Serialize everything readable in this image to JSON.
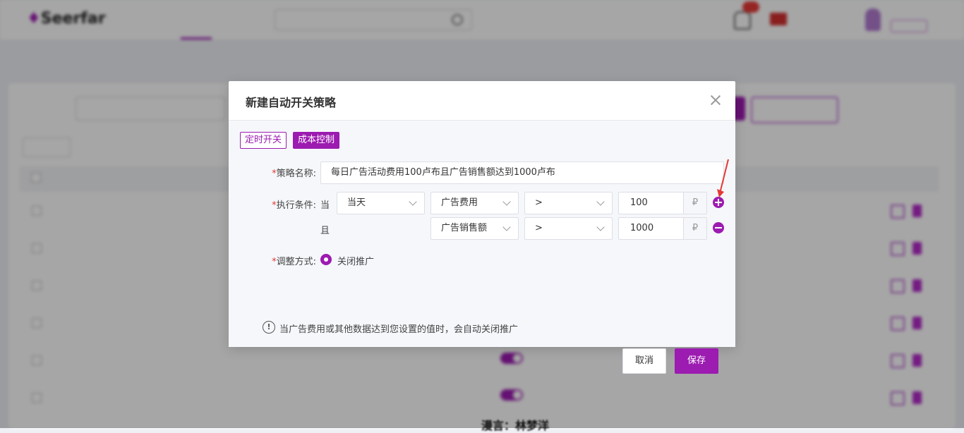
{
  "colors": {
    "accent": "#9c1bb0",
    "required": "#e53935",
    "arrow": "#e53935"
  },
  "dialog": {
    "title": "新建自动开关策略",
    "tabs": [
      {
        "label": "定时开关",
        "active": false
      },
      {
        "label": "成本控制",
        "active": true
      }
    ],
    "strategy_name": {
      "label": "策略名称:",
      "value": "每日广告活动费用100卢布且广告销售额达到1000卢布"
    },
    "condition_label": "执行条件:",
    "conditions": [
      {
        "conj": "当",
        "period": "当天",
        "metric": "广告费用",
        "operator": ">",
        "value": "100",
        "unit": "₽",
        "action_icon": "plus-circle-icon"
      },
      {
        "conj": "且",
        "period": "",
        "metric": "广告销售额",
        "operator": ">",
        "value": "1000",
        "unit": "₽",
        "action_icon": "minus-circle-icon"
      }
    ],
    "adjust": {
      "label": "调整方式:",
      "option": "关闭推广",
      "selected": true
    },
    "info": {
      "icon": "exclamation-circle-icon",
      "glyph": "!",
      "text": "当广告费用或其他数据达到您设置的值时，会自动关闭推广"
    },
    "buttons": {
      "cancel": "取消",
      "save": "保存"
    }
  },
  "watermark": "漫言：林梦洋"
}
